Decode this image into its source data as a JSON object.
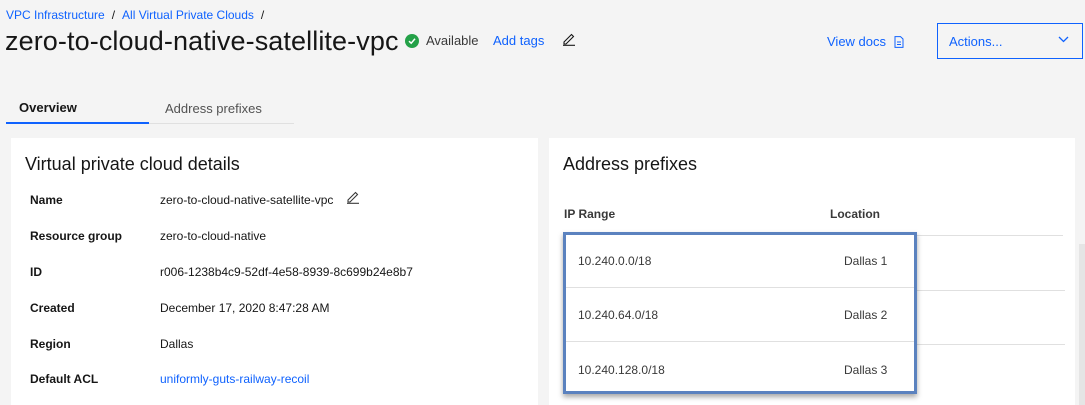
{
  "breadcrumb": {
    "item1": "VPC Infrastructure",
    "item2": "All Virtual Private Clouds",
    "sep": "/"
  },
  "header": {
    "title": "zero-to-cloud-native-satellite-vpc",
    "status": "Available",
    "add_tags": "Add tags",
    "view_docs": "View docs",
    "actions": "Actions...",
    "status_color": "#24a148",
    "accent_color": "#0f62fe"
  },
  "tabs": [
    {
      "label": "Overview"
    },
    {
      "label": "Address prefixes"
    }
  ],
  "details": {
    "title": "Virtual private cloud details",
    "rows": [
      {
        "key": "Name",
        "value": "zero-to-cloud-native-satellite-vpc"
      },
      {
        "key": "Resource group",
        "value": "zero-to-cloud-native"
      },
      {
        "key": "ID",
        "value": "r006-1238b4c9-52df-4e58-8939-8c699b24e8b7"
      },
      {
        "key": "Created",
        "value": "December 17, 2020 8:47:28 AM"
      },
      {
        "key": "Region",
        "value": "Dallas"
      },
      {
        "key": "Default ACL",
        "value": "uniformly-guts-railway-recoil"
      }
    ]
  },
  "prefixes": {
    "title": "Address prefixes",
    "col_ip": "IP Range",
    "col_location": "Location",
    "rows": [
      {
        "ip": "10.240.0.0/18",
        "location": "Dallas 1"
      },
      {
        "ip": "10.240.64.0/18",
        "location": "Dallas 2"
      },
      {
        "ip": "10.240.128.0/18",
        "location": "Dallas 3"
      }
    ]
  }
}
